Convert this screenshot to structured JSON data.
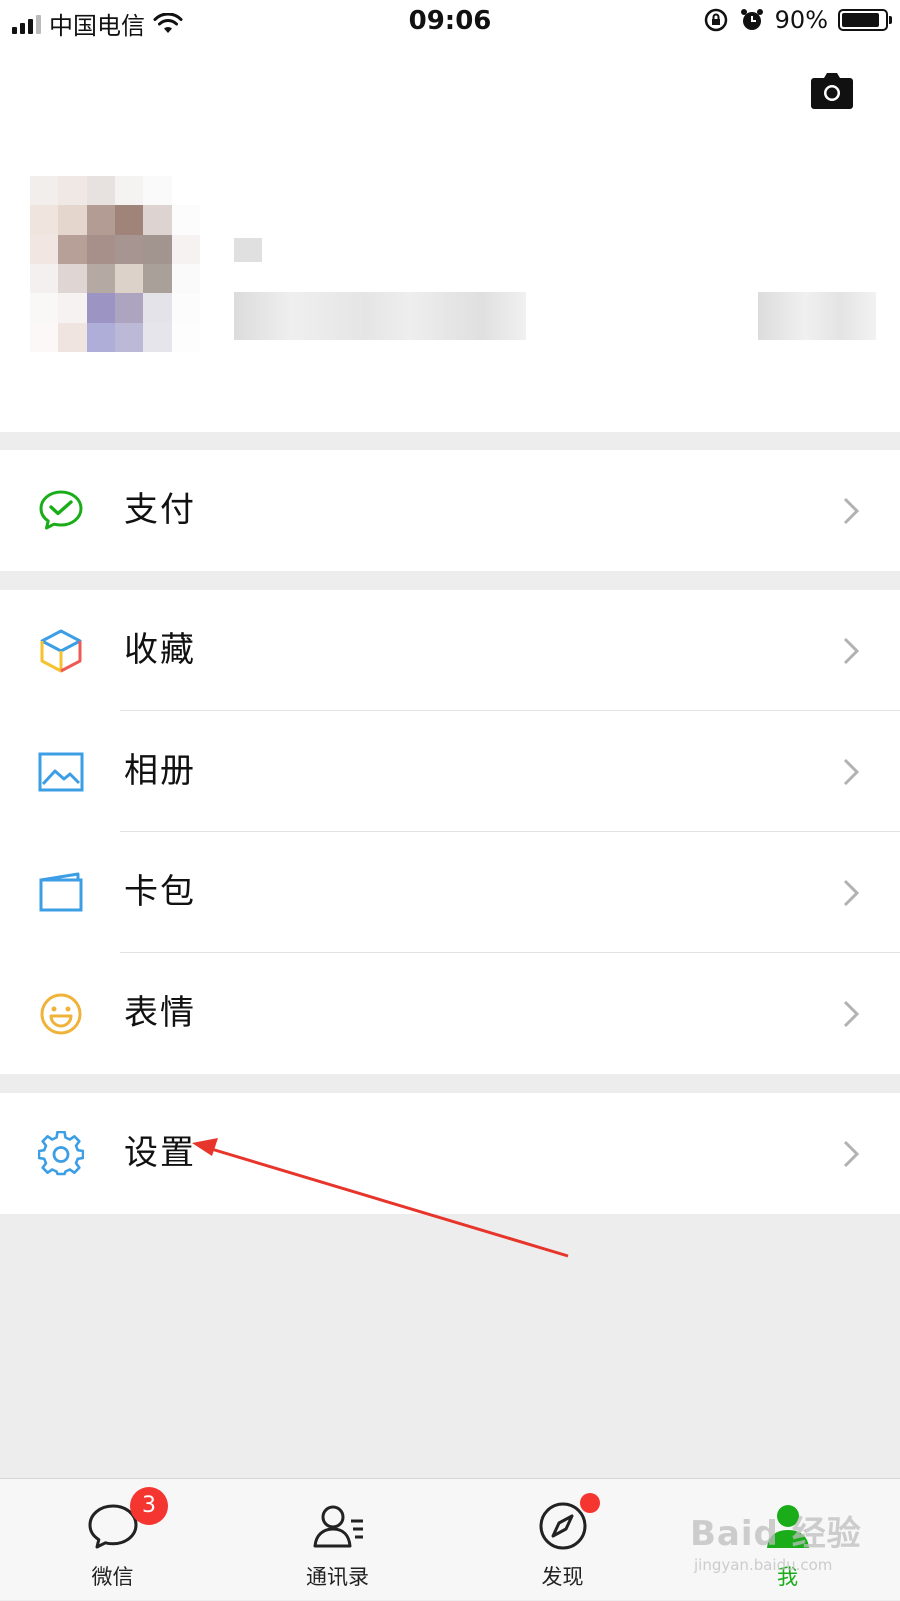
{
  "status_bar": {
    "carrier": "中国电信",
    "time": "09:06",
    "battery": "90%",
    "battery_level": 0.9,
    "icons": [
      "signal-icon",
      "wifi-icon",
      "rotation-lock-icon",
      "alarm-icon",
      "battery-icon"
    ]
  },
  "profile": {
    "camera_icon": "camera-icon",
    "avatar_colors": [
      [
        "#f2eeec",
        "#efe8e4",
        "#e7e2e0",
        "#f5f3f2",
        "#fbfafa",
        "#ffffff"
      ],
      [
        "#f0e4df",
        "#e4d5cd",
        "#b39c93",
        "#a08479",
        "#ddd4d2",
        "#fdfcfc"
      ],
      [
        "#f1e6e2",
        "#b7a097",
        "#a69089",
        "#a69590",
        "#a2948f",
        "#f6f2f1"
      ],
      [
        "#f4f0ef",
        "#dfd6d4",
        "#b5aaa3",
        "#dcd2c9",
        "#a8a099",
        "#fbfafa"
      ],
      [
        "#faf8f7",
        "#f5f2f1",
        "#9c95c3",
        "#ada4c0",
        "#e4e3ea",
        "#fdfcfc"
      ],
      [
        "#fbf8f7",
        "#f0e4e0",
        "#aeaed8",
        "#bcb9d6",
        "#e6e5ec",
        "#fdfdfd"
      ]
    ]
  },
  "menu": {
    "pay": {
      "label": "支付",
      "icon": "wechat-pay-icon"
    },
    "favorites": {
      "label": "收藏",
      "icon": "favorites-cube-icon"
    },
    "album": {
      "label": "相册",
      "icon": "album-icon"
    },
    "cards": {
      "label": "卡包",
      "icon": "card-wallet-icon"
    },
    "stickers": {
      "label": "表情",
      "icon": "sticker-smile-icon"
    },
    "settings": {
      "label": "设置",
      "icon": "settings-gear-icon"
    }
  },
  "tabbar": {
    "tabs": [
      {
        "label": "微信",
        "icon": "chats-icon",
        "badge": "3"
      },
      {
        "label": "通讯录",
        "icon": "contacts-icon"
      },
      {
        "label": "发现",
        "icon": "discover-compass-icon",
        "dot": true
      },
      {
        "label": "我",
        "icon": "me-icon",
        "active": true
      }
    ]
  },
  "colors": {
    "accent_green": "#1aad19",
    "badge_red": "#f43530",
    "annotation_arrow": "#e8352b"
  }
}
